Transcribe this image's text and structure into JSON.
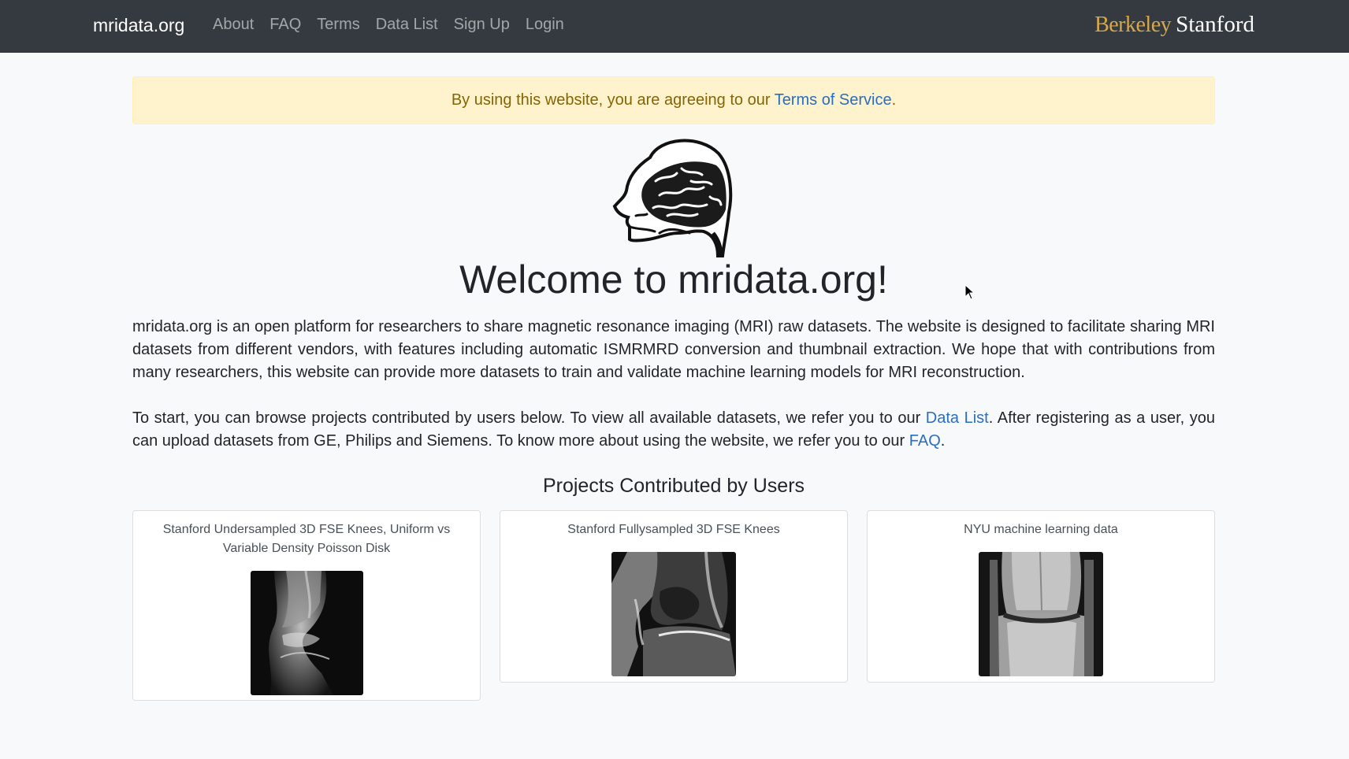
{
  "nav": {
    "brand": "mridata.org",
    "links": [
      "About",
      "FAQ",
      "Terms",
      "Data List",
      "Sign Up",
      "Login"
    ],
    "berkeley": "Berkeley",
    "stanford": "Stanford"
  },
  "alert": {
    "prefix": "By using this website, you are agreeing to our ",
    "link": "Terms of Service",
    "suffix": "."
  },
  "logo_icon": "brain-head-icon",
  "title": "Welcome to mridata.org!",
  "intro": "mridata.org is an open platform for researchers to share magnetic resonance imaging (MRI) raw datasets. The website is designed to facilitate sharing MRI datasets from different vendors, with features including automatic ISMRMRD conversion and thumbnail extraction. We hope that with contributions from many researchers, this website can provide more datasets to train and validate machine learning models for MRI reconstruction.",
  "start": {
    "part1": "To start, you can browse projects contributed by users below. To view all available datasets, we refer you to our ",
    "link1": "Data List",
    "part2": ". After registering as a user, you can upload datasets from GE, Philips and Siemens. To know more about using the website, we refer you to our ",
    "link2": "FAQ",
    "part3": "."
  },
  "projects_title": "Projects Contributed by Users",
  "projects": [
    {
      "title": "Stanford Undersampled 3D FSE Knees, Uniform vs Variable Density Poisson Disk",
      "thumbnail": "knee-sagittal-undersampled-image"
    },
    {
      "title": "Stanford Fullysampled 3D FSE Knees",
      "thumbnail": "knee-sagittal-fullysampled-image"
    },
    {
      "title": "NYU machine learning data",
      "thumbnail": "knee-coronal-image"
    }
  ],
  "colors": {
    "navbar": "#343a40",
    "alert_bg": "#fff3cd",
    "alert_text": "#856404",
    "link": "#2a6ebf",
    "berkeley": "#d6a84b"
  }
}
